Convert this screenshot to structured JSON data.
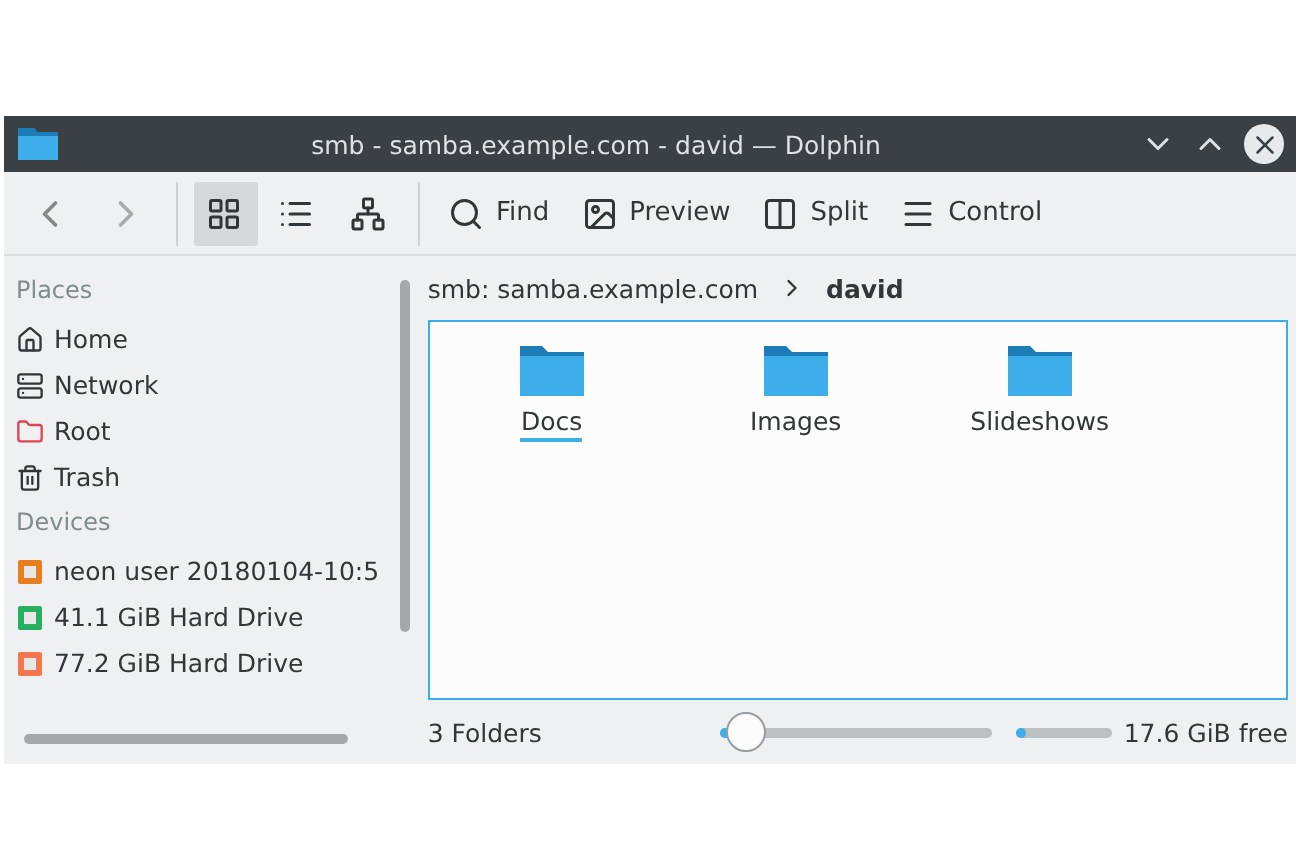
{
  "window": {
    "title": "smb - samba.example.com - david — Dolphin"
  },
  "toolbar": {
    "view_modes": [
      {
        "kind": "icons",
        "selected": true
      },
      {
        "kind": "details",
        "selected": false
      },
      {
        "kind": "tree",
        "selected": false
      }
    ],
    "actions": [
      {
        "kind": "find",
        "label": "Find"
      },
      {
        "kind": "preview",
        "label": "Preview"
      },
      {
        "kind": "split",
        "label": "Split"
      },
      {
        "kind": "control",
        "label": "Control"
      }
    ]
  },
  "sidebar": {
    "sections": [
      {
        "title": "Places",
        "items": [
          {
            "kind": "home",
            "label": "Home"
          },
          {
            "kind": "network",
            "label": "Network"
          },
          {
            "kind": "root",
            "label": "Root"
          },
          {
            "kind": "trash",
            "label": "Trash"
          }
        ]
      },
      {
        "title": "Devices",
        "items": [
          {
            "kind": "usb",
            "label": "neon user 20180104-10:5"
          },
          {
            "kind": "drive-green",
            "label": "41.1 GiB Hard Drive"
          },
          {
            "kind": "drive-orange",
            "label": "77.2 GiB Hard Drive"
          }
        ]
      }
    ]
  },
  "breadcrumb": [
    {
      "label": "smb: samba.example.com",
      "current": false
    },
    {
      "label": "david",
      "current": true
    }
  ],
  "folders": [
    {
      "name": "Docs",
      "selected": true
    },
    {
      "name": "Images",
      "selected": false
    },
    {
      "name": "Slideshows",
      "selected": false
    }
  ],
  "status_bar": {
    "count": "3 Folders",
    "zoom": {
      "level": 0.1
    },
    "free_space": {
      "level": 0.1,
      "text": "17.6 GiB free"
    }
  }
}
